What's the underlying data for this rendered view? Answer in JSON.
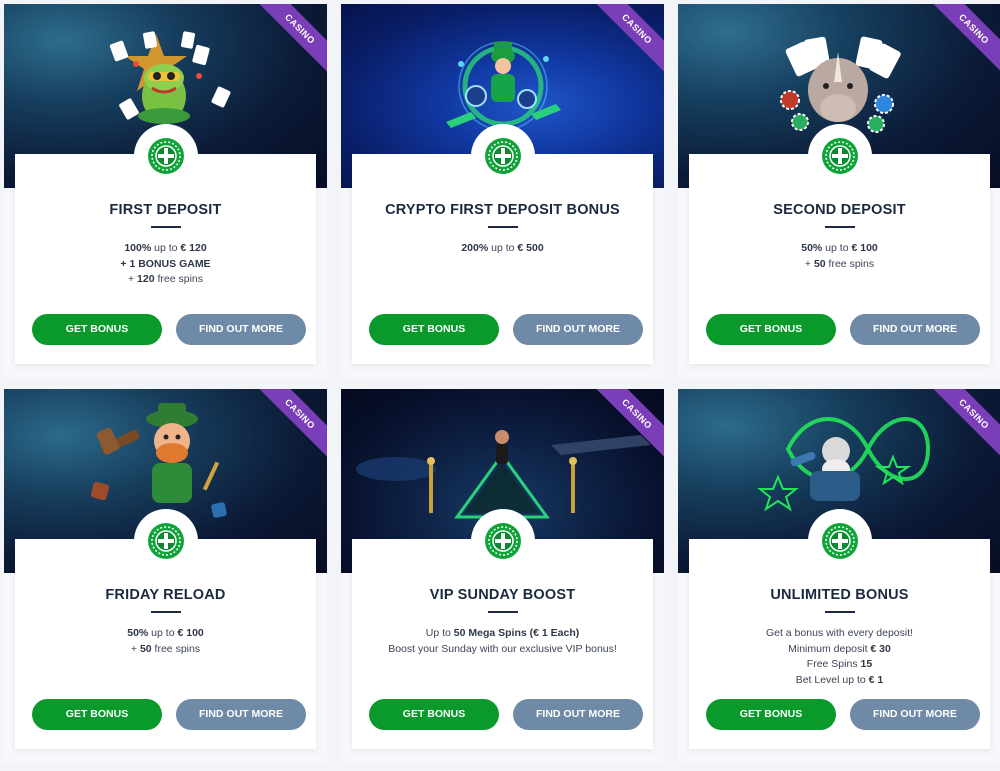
{
  "badge_label": "CASINO",
  "colors": {
    "get_bonus": "#0a9a2c",
    "find_out_more": "#6f8aa7",
    "ribbon": "#7a3fb8",
    "title": "#1b2a3e"
  },
  "buttons": {
    "get_bonus": "GET BONUS",
    "find_out_more": "FIND OUT MORE"
  },
  "offers": [
    {
      "title": "FIRST DEPOSIT",
      "illustration": "frog-with-cards-icon",
      "lines": [
        {
          "strong": "100%",
          "text": " up to ",
          "strong2": "€ 120"
        },
        {
          "strong": "+ 1 BONUS GAME"
        },
        {
          "text": "+ ",
          "strong": "120",
          "text2": " free spins"
        }
      ]
    },
    {
      "title": "CRYPTO FIRST DEPOSIT BONUS",
      "illustration": "leprechaun-crypto-icon",
      "lines": [
        {
          "strong": "200%",
          "text": " up to ",
          "strong2": "€ 500"
        }
      ]
    },
    {
      "title": "SECOND DEPOSIT",
      "illustration": "rhino-chips-icon",
      "lines": [
        {
          "strong": "50%",
          "text": " up to ",
          "strong2": "€ 100"
        },
        {
          "text": "+ ",
          "strong": "50",
          "text2": " free spins"
        }
      ]
    },
    {
      "title": "FRIDAY RELOAD",
      "illustration": "leprechaun-hammer-icon",
      "lines": [
        {
          "strong": "50%",
          "text": " up to ",
          "strong2": "€ 100"
        },
        {
          "text": "+ ",
          "strong": "50",
          "text2": " free spins"
        }
      ]
    },
    {
      "title": "VIP SUNDAY BOOST",
      "illustration": "vip-stage-icon",
      "lines": [
        {
          "text": "Up to ",
          "strong": "50 Mega Spins (€ 1 Each)"
        },
        {
          "text": "Boost your Sunday with our exclusive VIP bonus!"
        }
      ]
    },
    {
      "title": "UNLIMITED BONUS",
      "illustration": "wizard-infinity-icon",
      "lines": [
        {
          "text": "Get a bonus with every deposit!"
        },
        {
          "text": "Minimum deposit ",
          "strong": "€ 30"
        },
        {
          "text": "Free Spins ",
          "strong": "15"
        },
        {
          "text": "Bet Level up to ",
          "strong": "€ 1"
        }
      ]
    }
  ]
}
